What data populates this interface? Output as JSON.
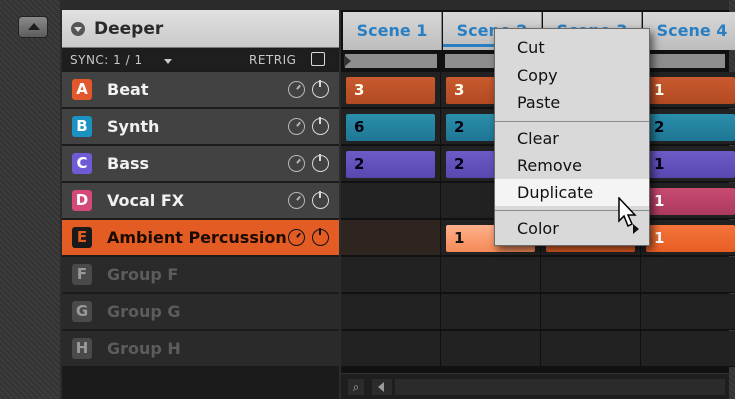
{
  "group_panel": {
    "title": "Deeper",
    "sync_label": "SYNC: 1 / 1",
    "retrig_label": "RETRIG",
    "groups": [
      {
        "letter": "A",
        "name": "Beat",
        "color": "#e2572b",
        "state": "active"
      },
      {
        "letter": "B",
        "name": "Synth",
        "color": "#1b93c2",
        "state": "active"
      },
      {
        "letter": "C",
        "name": "Bass",
        "color": "#6f5bd6",
        "state": "active"
      },
      {
        "letter": "D",
        "name": "Vocal FX",
        "color": "#d5487a",
        "state": "active"
      },
      {
        "letter": "E",
        "name": "Ambient Percussion",
        "color": "#e25c24",
        "state": "selected"
      },
      {
        "letter": "F",
        "name": "Group F",
        "state": "empty"
      },
      {
        "letter": "G",
        "name": "Group G",
        "state": "empty"
      },
      {
        "letter": "H",
        "name": "Group H",
        "state": "empty"
      }
    ]
  },
  "scenes": {
    "tabs": [
      "Scene 1",
      "Scene 2",
      "Scene 3",
      "Scene 4"
    ],
    "clips": {
      "beat": [
        "3",
        "3",
        "1"
      ],
      "synth": [
        "6",
        "2",
        "2"
      ],
      "bass": [
        "2",
        "2",
        "1"
      ],
      "vocal": [
        "1"
      ],
      "ambient": [
        "1",
        "1"
      ]
    },
    "footer_icon": "magnifier-icon"
  },
  "context_menu": {
    "items": [
      "Cut",
      "Copy",
      "Paste",
      "Clear",
      "Remove",
      "Duplicate",
      "Color"
    ],
    "hovered": "Duplicate"
  },
  "colors": {
    "accent_blue": "#2a7fc3",
    "selected_orange": "#e25c24"
  }
}
